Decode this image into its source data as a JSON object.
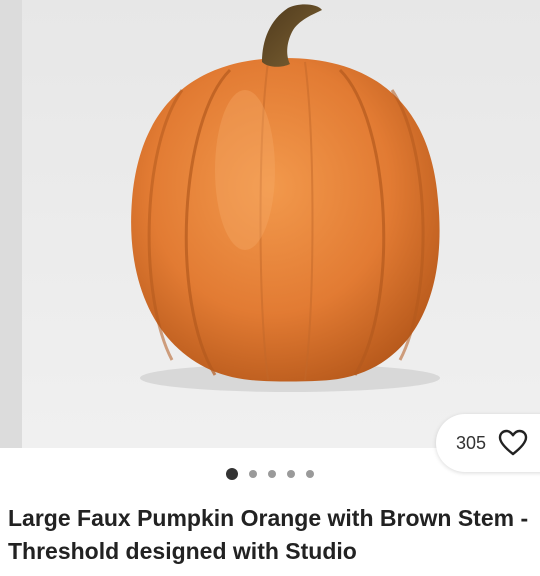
{
  "listing": {
    "favorites": {
      "count": "305",
      "icon": "heart-outline-icon"
    },
    "carousel": {
      "total_images": 5,
      "active_index": 1
    },
    "title": "Large Faux Pumpkin Orange with Brown Stem - Threshold designed with Studio"
  },
  "colors": {
    "pumpkin": "#e8833a",
    "stem": "#6b4f2a",
    "background": "#ececec"
  }
}
